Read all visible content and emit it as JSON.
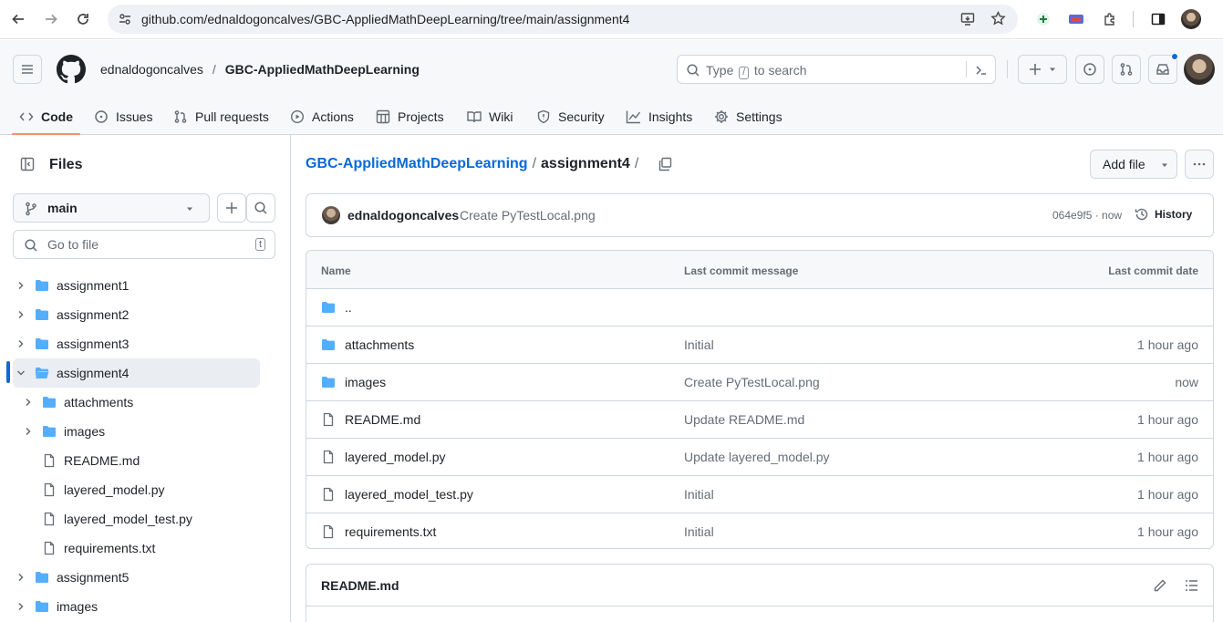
{
  "browser": {
    "url": "github.com/ednaldogoncalves/GBC-AppliedMathDeepLearning/tree/main/assignment4"
  },
  "header": {
    "owner": "ednaldogoncalves",
    "separator": "/",
    "repo": "GBC-AppliedMathDeepLearning",
    "search_prefix": "Type",
    "search_key": "/",
    "search_suffix": "to search"
  },
  "tabs": [
    {
      "label": "Code",
      "icon": "code-icon",
      "active": true
    },
    {
      "label": "Issues",
      "icon": "issue-icon"
    },
    {
      "label": "Pull requests",
      "icon": "pull-request-icon"
    },
    {
      "label": "Actions",
      "icon": "actions-icon"
    },
    {
      "label": "Projects",
      "icon": "projects-icon"
    },
    {
      "label": "Wiki",
      "icon": "wiki-icon"
    },
    {
      "label": "Security",
      "icon": "shield-icon"
    },
    {
      "label": "Insights",
      "icon": "graph-icon"
    },
    {
      "label": "Settings",
      "icon": "gear-icon"
    }
  ],
  "sidebar": {
    "title": "Files",
    "branch": "main",
    "goto_placeholder": "Go to file",
    "goto_key": "t",
    "tree": [
      {
        "name": "assignment1",
        "type": "folder",
        "expanded": false
      },
      {
        "name": "assignment2",
        "type": "folder",
        "expanded": false
      },
      {
        "name": "assignment3",
        "type": "folder",
        "expanded": false
      },
      {
        "name": "assignment4",
        "type": "folder",
        "expanded": true,
        "selected": true
      },
      {
        "name": "attachments",
        "type": "folder",
        "expanded": false,
        "child": true
      },
      {
        "name": "images",
        "type": "folder",
        "expanded": false,
        "child": true
      },
      {
        "name": "README.md",
        "type": "file",
        "child": true
      },
      {
        "name": "layered_model.py",
        "type": "file",
        "child": true
      },
      {
        "name": "layered_model_test.py",
        "type": "file",
        "child": true
      },
      {
        "name": "requirements.txt",
        "type": "file",
        "child": true
      },
      {
        "name": "assignment5",
        "type": "folder",
        "expanded": false
      },
      {
        "name": "images",
        "type": "folder",
        "expanded": false
      }
    ]
  },
  "main": {
    "breadcrumb_repo": "GBC-AppliedMathDeepLearning",
    "breadcrumb_dir": "assignment4",
    "breadcrumb_sep": "/",
    "add_file_label": "Add file",
    "commit": {
      "author": "ednaldogoncalves",
      "message": "Create PyTestLocal.png",
      "sha_time": "064e9f5 · now",
      "history_label": "History"
    },
    "table": {
      "headers": {
        "name": "Name",
        "message": "Last commit message",
        "date": "Last commit date"
      },
      "rows": [
        {
          "name": "..",
          "type": "folder",
          "message": "",
          "date": ""
        },
        {
          "name": "attachments",
          "type": "folder",
          "message": "Initial",
          "date": "1 hour ago"
        },
        {
          "name": "images",
          "type": "folder",
          "message": "Create PyTestLocal.png",
          "date": "now"
        },
        {
          "name": "README.md",
          "type": "file",
          "message": "Update README.md",
          "date": "1 hour ago"
        },
        {
          "name": "layered_model.py",
          "type": "file",
          "message": "Update layered_model.py",
          "date": "1 hour ago"
        },
        {
          "name": "layered_model_test.py",
          "type": "file",
          "message": "Initial",
          "date": "1 hour ago"
        },
        {
          "name": "requirements.txt",
          "type": "file",
          "message": "Initial",
          "date": "1 hour ago"
        }
      ]
    },
    "readme_title": "README.md"
  },
  "colors": {
    "link": "#0969da",
    "folder": "#54aeff",
    "active_tab_underline": "#fd8c73",
    "border": "#d0d7de",
    "muted": "#656d76"
  }
}
